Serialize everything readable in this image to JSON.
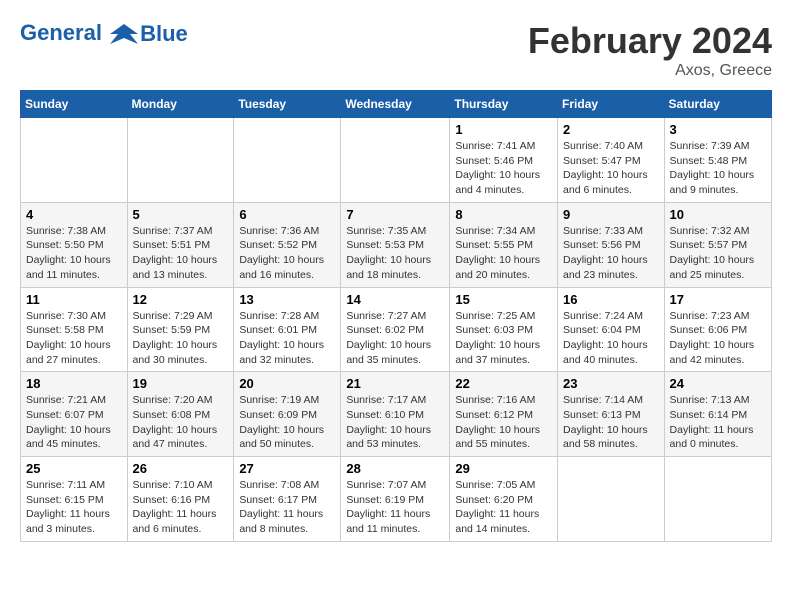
{
  "header": {
    "logo_line1": "General",
    "logo_line2": "Blue",
    "month": "February 2024",
    "location": "Axos, Greece"
  },
  "weekdays": [
    "Sunday",
    "Monday",
    "Tuesday",
    "Wednesday",
    "Thursday",
    "Friday",
    "Saturday"
  ],
  "weeks": [
    [
      {
        "day": "",
        "info": ""
      },
      {
        "day": "",
        "info": ""
      },
      {
        "day": "",
        "info": ""
      },
      {
        "day": "",
        "info": ""
      },
      {
        "day": "1",
        "info": "Sunrise: 7:41 AM\nSunset: 5:46 PM\nDaylight: 10 hours\nand 4 minutes."
      },
      {
        "day": "2",
        "info": "Sunrise: 7:40 AM\nSunset: 5:47 PM\nDaylight: 10 hours\nand 6 minutes."
      },
      {
        "day": "3",
        "info": "Sunrise: 7:39 AM\nSunset: 5:48 PM\nDaylight: 10 hours\nand 9 minutes."
      }
    ],
    [
      {
        "day": "4",
        "info": "Sunrise: 7:38 AM\nSunset: 5:50 PM\nDaylight: 10 hours\nand 11 minutes."
      },
      {
        "day": "5",
        "info": "Sunrise: 7:37 AM\nSunset: 5:51 PM\nDaylight: 10 hours\nand 13 minutes."
      },
      {
        "day": "6",
        "info": "Sunrise: 7:36 AM\nSunset: 5:52 PM\nDaylight: 10 hours\nand 16 minutes."
      },
      {
        "day": "7",
        "info": "Sunrise: 7:35 AM\nSunset: 5:53 PM\nDaylight: 10 hours\nand 18 minutes."
      },
      {
        "day": "8",
        "info": "Sunrise: 7:34 AM\nSunset: 5:55 PM\nDaylight: 10 hours\nand 20 minutes."
      },
      {
        "day": "9",
        "info": "Sunrise: 7:33 AM\nSunset: 5:56 PM\nDaylight: 10 hours\nand 23 minutes."
      },
      {
        "day": "10",
        "info": "Sunrise: 7:32 AM\nSunset: 5:57 PM\nDaylight: 10 hours\nand 25 minutes."
      }
    ],
    [
      {
        "day": "11",
        "info": "Sunrise: 7:30 AM\nSunset: 5:58 PM\nDaylight: 10 hours\nand 27 minutes."
      },
      {
        "day": "12",
        "info": "Sunrise: 7:29 AM\nSunset: 5:59 PM\nDaylight: 10 hours\nand 30 minutes."
      },
      {
        "day": "13",
        "info": "Sunrise: 7:28 AM\nSunset: 6:01 PM\nDaylight: 10 hours\nand 32 minutes."
      },
      {
        "day": "14",
        "info": "Sunrise: 7:27 AM\nSunset: 6:02 PM\nDaylight: 10 hours\nand 35 minutes."
      },
      {
        "day": "15",
        "info": "Sunrise: 7:25 AM\nSunset: 6:03 PM\nDaylight: 10 hours\nand 37 minutes."
      },
      {
        "day": "16",
        "info": "Sunrise: 7:24 AM\nSunset: 6:04 PM\nDaylight: 10 hours\nand 40 minutes."
      },
      {
        "day": "17",
        "info": "Sunrise: 7:23 AM\nSunset: 6:06 PM\nDaylight: 10 hours\nand 42 minutes."
      }
    ],
    [
      {
        "day": "18",
        "info": "Sunrise: 7:21 AM\nSunset: 6:07 PM\nDaylight: 10 hours\nand 45 minutes."
      },
      {
        "day": "19",
        "info": "Sunrise: 7:20 AM\nSunset: 6:08 PM\nDaylight: 10 hours\nand 47 minutes."
      },
      {
        "day": "20",
        "info": "Sunrise: 7:19 AM\nSunset: 6:09 PM\nDaylight: 10 hours\nand 50 minutes."
      },
      {
        "day": "21",
        "info": "Sunrise: 7:17 AM\nSunset: 6:10 PM\nDaylight: 10 hours\nand 53 minutes."
      },
      {
        "day": "22",
        "info": "Sunrise: 7:16 AM\nSunset: 6:12 PM\nDaylight: 10 hours\nand 55 minutes."
      },
      {
        "day": "23",
        "info": "Sunrise: 7:14 AM\nSunset: 6:13 PM\nDaylight: 10 hours\nand 58 minutes."
      },
      {
        "day": "24",
        "info": "Sunrise: 7:13 AM\nSunset: 6:14 PM\nDaylight: 11 hours\nand 0 minutes."
      }
    ],
    [
      {
        "day": "25",
        "info": "Sunrise: 7:11 AM\nSunset: 6:15 PM\nDaylight: 11 hours\nand 3 minutes."
      },
      {
        "day": "26",
        "info": "Sunrise: 7:10 AM\nSunset: 6:16 PM\nDaylight: 11 hours\nand 6 minutes."
      },
      {
        "day": "27",
        "info": "Sunrise: 7:08 AM\nSunset: 6:17 PM\nDaylight: 11 hours\nand 8 minutes."
      },
      {
        "day": "28",
        "info": "Sunrise: 7:07 AM\nSunset: 6:19 PM\nDaylight: 11 hours\nand 11 minutes."
      },
      {
        "day": "29",
        "info": "Sunrise: 7:05 AM\nSunset: 6:20 PM\nDaylight: 11 hours\nand 14 minutes."
      },
      {
        "day": "",
        "info": ""
      },
      {
        "day": "",
        "info": ""
      }
    ]
  ]
}
